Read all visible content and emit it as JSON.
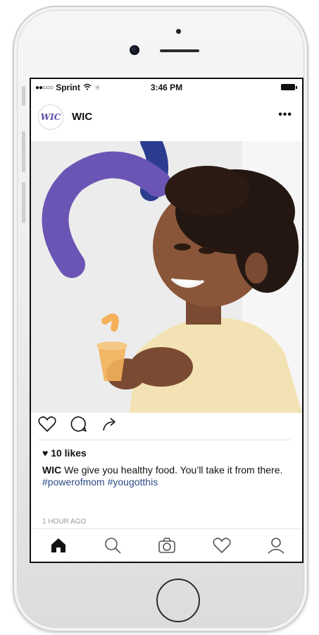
{
  "status_bar": {
    "carrier": "Sprint",
    "time": "3:46 PM"
  },
  "post": {
    "username": "WIC",
    "avatar_text": "WIC",
    "more_label": "•••",
    "likes": "10 likes",
    "caption_user": "WIC",
    "caption_text": "We give you healthy food. You’ll take it from there.",
    "hashtags": "#powerofmom #yougotthis",
    "timestamp": "1 HOUR AGO"
  },
  "icons": {
    "like": "heart-icon",
    "comment": "comment-icon",
    "share": "share-icon",
    "home": "home-icon",
    "search": "search-icon",
    "camera": "camera-icon",
    "activity": "heart-icon",
    "profile": "profile-icon"
  },
  "colors": {
    "brand_purple": "#6a55b4",
    "hashtag_blue": "#2b4a86"
  }
}
